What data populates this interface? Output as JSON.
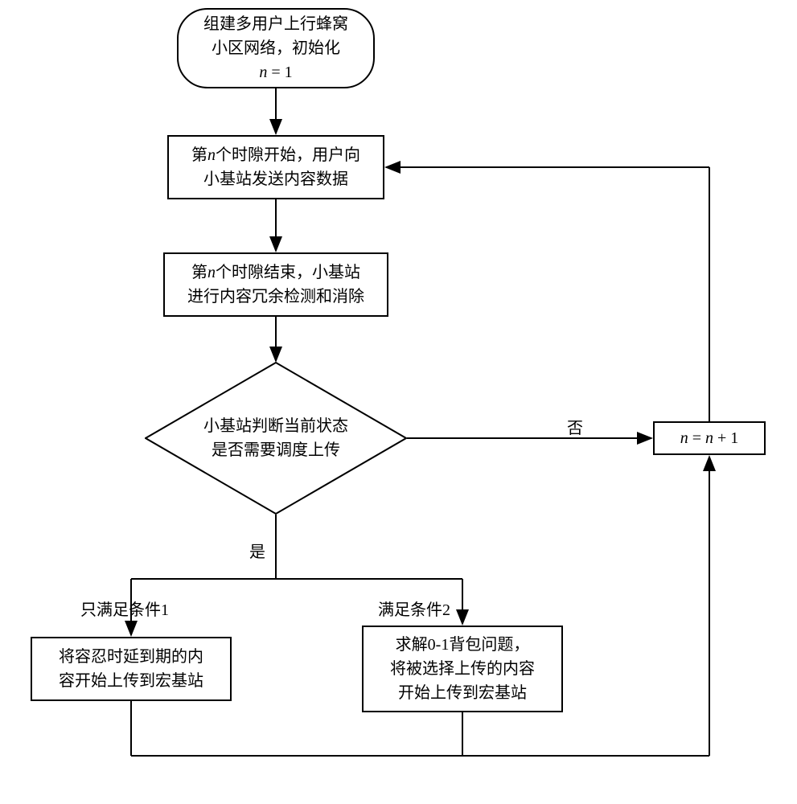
{
  "chart_data": {
    "type": "flowchart",
    "nodes": [
      {
        "id": "start",
        "shape": "terminator",
        "text_lines": [
          "组建多用户上行蜂窝",
          "小区网络，初始化",
          "n = 1"
        ]
      },
      {
        "id": "step1",
        "shape": "process",
        "text_lines": [
          "第n个时隙开始，用户向",
          "小基站发送内容数据"
        ]
      },
      {
        "id": "step2",
        "shape": "process",
        "text_lines": [
          "第n个时隙结束，小基站",
          "进行内容冗余检测和消除"
        ]
      },
      {
        "id": "decision",
        "shape": "decision",
        "text_lines": [
          "小基站判断当前状态",
          "是否需要调度上传"
        ]
      },
      {
        "id": "left",
        "shape": "process",
        "text_lines": [
          "将容忍时延到期的内",
          "容开始上传到宏基站"
        ]
      },
      {
        "id": "right",
        "shape": "process",
        "text_lines": [
          "求解0-1背包问题，",
          "将被选择上传的内容",
          "开始上传到宏基站"
        ]
      },
      {
        "id": "inc",
        "shape": "process",
        "text": "n = n + 1"
      }
    ],
    "edges": [
      {
        "from": "start",
        "to": "step1"
      },
      {
        "from": "step1",
        "to": "step2"
      },
      {
        "from": "step2",
        "to": "decision"
      },
      {
        "from": "decision",
        "to": "inc",
        "label": "否"
      },
      {
        "from": "decision",
        "to": "left",
        "label": "是 / 只满足条件1"
      },
      {
        "from": "decision",
        "to": "right",
        "label": "是 / 满足条件2"
      },
      {
        "from": "left",
        "to": "inc"
      },
      {
        "from": "right",
        "to": "inc"
      },
      {
        "from": "inc",
        "to": "step1"
      }
    ]
  },
  "start": {
    "line1": "组建多用户上行蜂窝",
    "line2": "小区网络，初始化",
    "line3a": "n",
    "line3b": " = 1"
  },
  "step1": {
    "pre": "第",
    "n": "n",
    "post1": "个时隙开始，用户向",
    "line2": "小基站发送内容数据"
  },
  "step2": {
    "pre": "第",
    "n": "n",
    "post1": "个时隙结束，小基站",
    "line2": "进行内容冗余检测和消除"
  },
  "decision": {
    "line1": "小基站判断当前状态",
    "line2": "是否需要调度上传"
  },
  "left": {
    "line1": "将容忍时延到期的内",
    "line2": "容开始上传到宏基站"
  },
  "right": {
    "line1": "求解0-1背包问题，",
    "line2": "将被选择上传的内容",
    "line3": "开始上传到宏基站"
  },
  "inc": {
    "n1": "n",
    "eq": " = ",
    "n2": "n",
    "plus": " + 1"
  },
  "labels": {
    "no": "否",
    "yes": "是",
    "cond1": "只满足条件1",
    "cond2": "满足条件2"
  }
}
